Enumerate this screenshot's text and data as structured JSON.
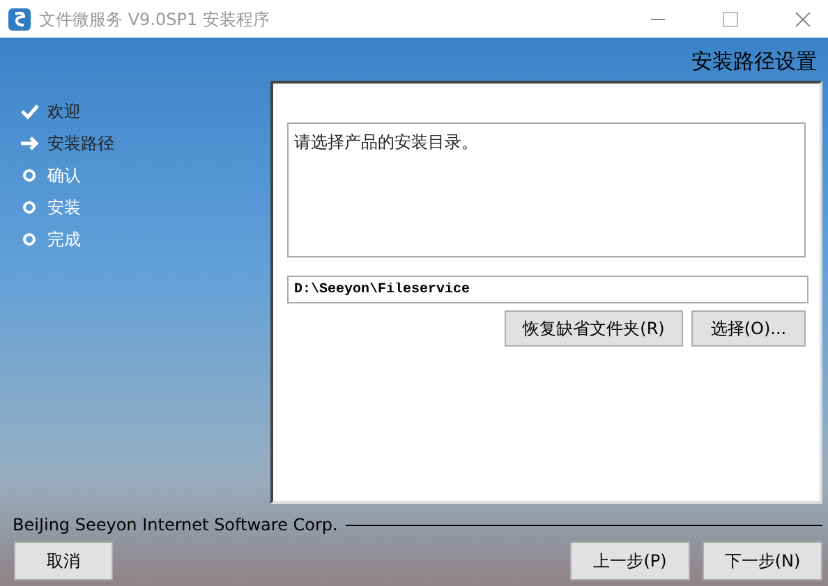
{
  "window": {
    "title": "文件微服务 V9.0SP1 安装程序"
  },
  "header": {
    "title": "安装路径设置"
  },
  "steps": [
    {
      "label": "欢迎",
      "kind": "done"
    },
    {
      "label": "安装路径",
      "kind": "current"
    },
    {
      "label": "确认",
      "kind": "pending"
    },
    {
      "label": "安装",
      "kind": "pending"
    },
    {
      "label": "完成",
      "kind": "pending"
    }
  ],
  "panel": {
    "message": "请选择产品的安装目录。",
    "path": "D:\\Seeyon\\Fileservice",
    "buttons": [
      "恢复缺省文件夹(R)",
      "选择(O)..."
    ]
  },
  "footer": {
    "company": "BeiJing Seeyon Internet Software Corp.",
    "cancel": "取消",
    "back": "上一步(P)",
    "next": "下一步(N)"
  }
}
